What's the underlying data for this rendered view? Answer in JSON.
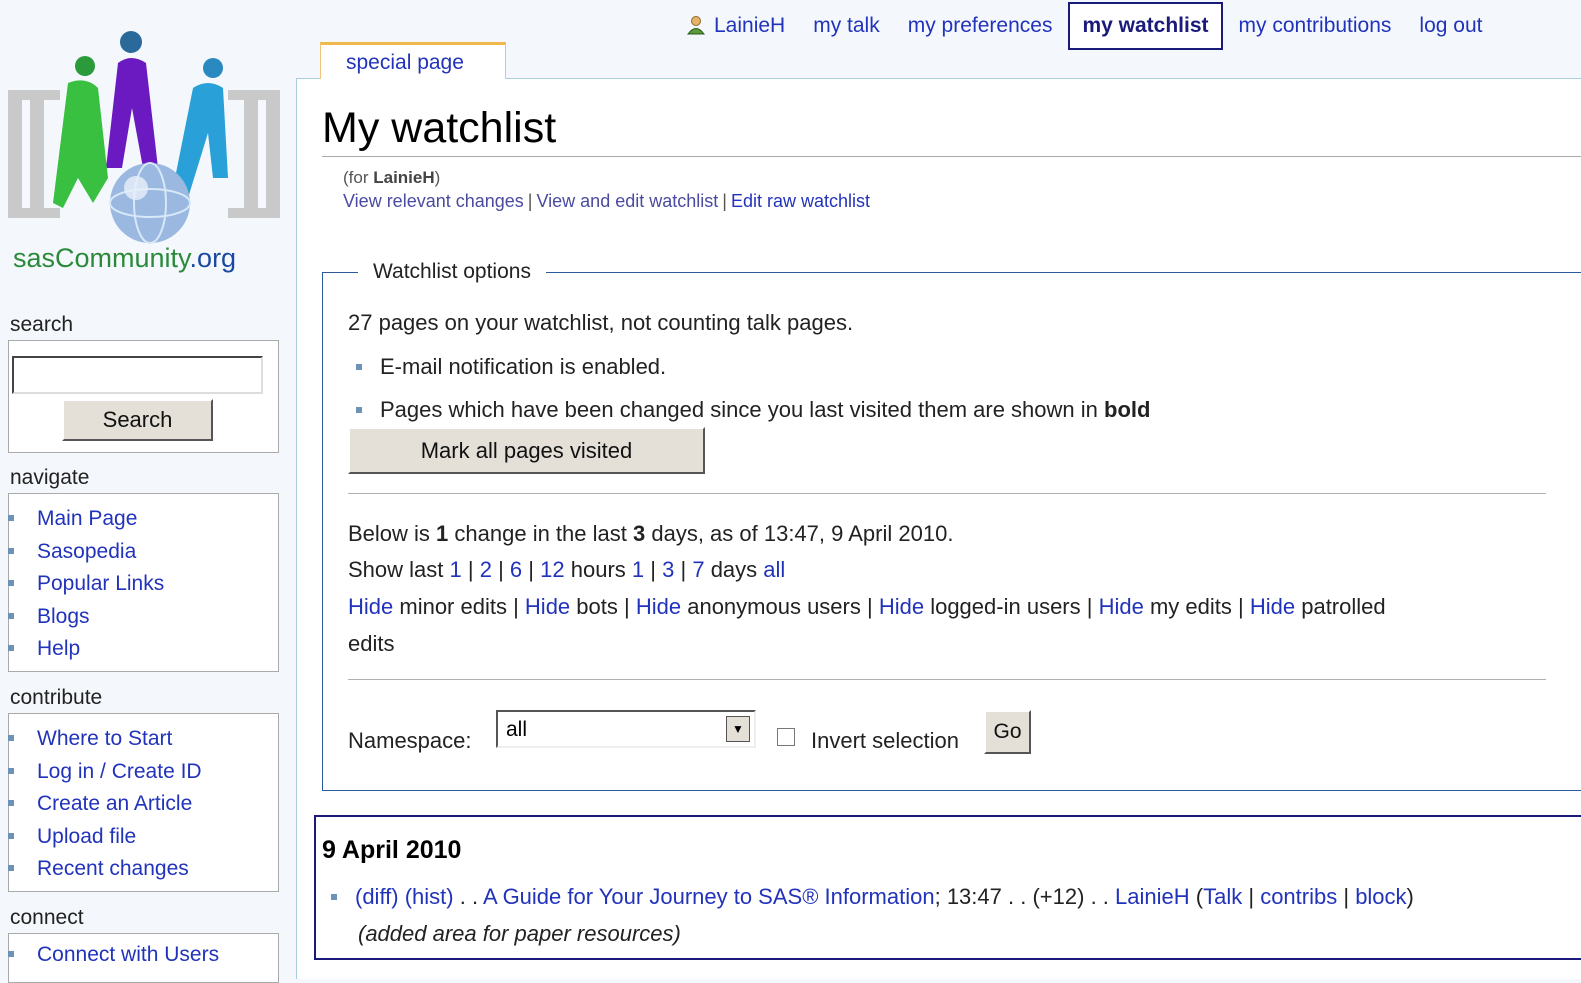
{
  "personal": {
    "user": "LainieH",
    "talk": "my talk",
    "preferences": "my preferences",
    "watchlist": "my watchlist",
    "contributions": "my contributions",
    "logout": "log out"
  },
  "tab": {
    "label": "special page"
  },
  "page": {
    "title": "My watchlist",
    "for_prefix": "(for ",
    "for_user": "LainieH",
    "for_suffix": ")",
    "links": [
      "View relevant changes",
      "View and edit watchlist",
      "Edit raw watchlist"
    ]
  },
  "options": {
    "legend": "Watchlist options",
    "count_text": "27 pages on your watchlist, not counting talk pages.",
    "bullet1": "E-mail notification is enabled.",
    "bullet2_prefix": "Pages which have been changed since you last visited them are shown in ",
    "bullet2_bold": "bold",
    "mark_button": "Mark all pages visited",
    "below_a": "Below is ",
    "below_count": "1",
    "below_b": " change in the last ",
    "below_days": "3",
    "below_c": " days, as of 13:47, 9 April 2010.",
    "show_last": "Show last",
    "hours_opts": [
      "1",
      "2",
      "6",
      "12"
    ],
    "hours_word": "hours",
    "days_opts": [
      "1",
      "3",
      "7"
    ],
    "days_word": "days",
    "all_word": "all",
    "hide": "Hide",
    "hide_targets": [
      "minor edits",
      "bots",
      "anonymous users",
      "logged-in users",
      "my edits",
      "patrolled edits"
    ],
    "namespace_label": "Namespace:",
    "namespace_value": "all",
    "invert_label": "Invert selection",
    "go": "Go"
  },
  "changes": {
    "date": "9 April 2010",
    "diff": "(diff)",
    "hist": "(hist)",
    "dots": ". .",
    "page": "A Guide for Your Journey to SAS® Information",
    "time": "; 13:47",
    "size": "(+12)",
    "user": "LainieH",
    "talk": "Talk",
    "contribs": "contribs",
    "block": "block",
    "comment": "(added area for paper resources)"
  },
  "sidebar": {
    "site_name_a": "sasCommunity",
    "site_name_b": ".org",
    "search_heading": "search",
    "search_button": "Search",
    "navigate_heading": "navigate",
    "navigate": [
      "Main Page",
      "Sasopedia",
      "Popular Links",
      "Blogs",
      "Help"
    ],
    "contribute_heading": "contribute",
    "contribute": [
      "Where to Start",
      "Log in / Create ID",
      "Create an Article",
      "Upload file",
      "Recent changes"
    ],
    "connect_heading": "connect",
    "connect": [
      "Connect with Users"
    ]
  }
}
